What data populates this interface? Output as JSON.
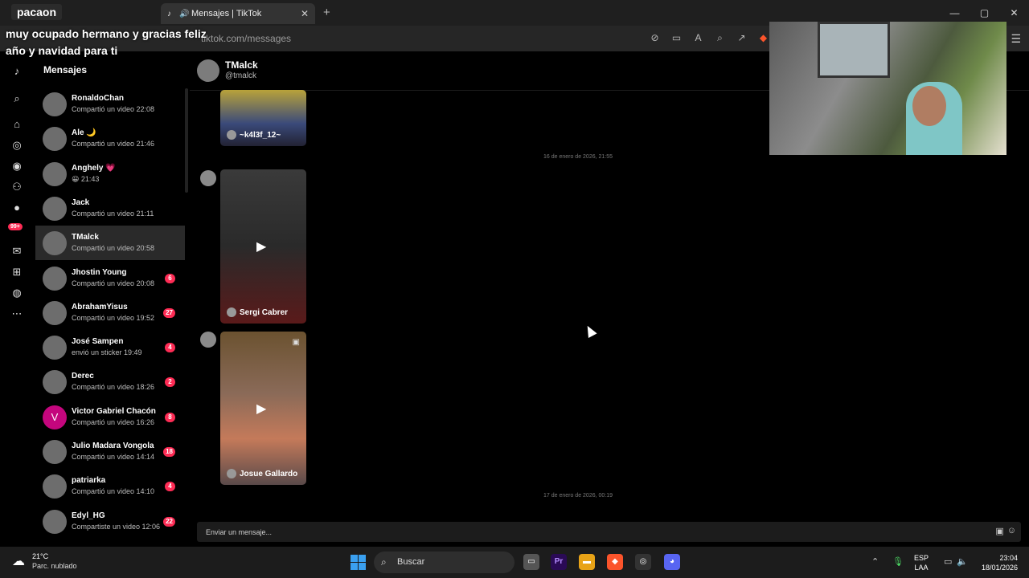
{
  "stream": {
    "user_tag": "pacaon",
    "message": "muy ocupado hermano y gracias feliz año y navidad para ti"
  },
  "browser": {
    "tab_title": "Mensajes | TikTok",
    "new_tab": "+",
    "url": "tiktok.com/messages",
    "win_min": "—",
    "win_max": "▢",
    "win_close": "✕"
  },
  "sidebar": {
    "title": "Mensajes",
    "rail_badge": "99+",
    "conversations": [
      {
        "name": "RonaldoChan",
        "preview": "Compartió un video 22:08",
        "count": ""
      },
      {
        "name": "Ale 🌙",
        "preview": "Compartió un video 21:46",
        "count": ""
      },
      {
        "name": "Anghely 💗",
        "preview": "😀 21:43",
        "count": ""
      },
      {
        "name": "Jack",
        "preview": "Compartió un video 21:11",
        "count": ""
      },
      {
        "name": "TMalck",
        "preview": "Compartió un video 20:58",
        "count": ""
      },
      {
        "name": "Jhostin Young",
        "preview": "Compartió un video 20:08",
        "count": "6"
      },
      {
        "name": "AbrahamYisus",
        "preview": "Compartió un video 19:52",
        "count": "27"
      },
      {
        "name": "José Sampen",
        "preview": "envió un sticker 19:49",
        "count": "4"
      },
      {
        "name": "Derec",
        "preview": "Compartió un video 18:26",
        "count": "2"
      },
      {
        "name": "Victor Gabriel Chacón",
        "preview": "Compartió un video 16:26",
        "count": "8",
        "initial": "V"
      },
      {
        "name": "Julio Madara Vongola",
        "preview": "Compartió un video 14:14",
        "count": "18"
      },
      {
        "name": "patriarka",
        "preview": "Compartió un video 14:10",
        "count": "4"
      },
      {
        "name": "Edyl_HG",
        "preview": "Compartiste un video 12:06",
        "count": "22"
      }
    ]
  },
  "chat": {
    "name": "TMalck",
    "handle": "@tmalck",
    "cards": [
      {
        "author": "~k4l3f_12~"
      },
      {
        "author": "Sergi Cabrer"
      },
      {
        "author": "Josue Gallardo"
      }
    ],
    "dates": [
      "16 de enero de 2026, 21:55",
      "17 de enero de 2026, 00:19"
    ],
    "composer_placeholder": "Enviar un mensaje..."
  },
  "taskbar": {
    "temperature": "21°C",
    "condition": "Parc. nublado",
    "search_label": "Buscar",
    "lang_line1": "ESP",
    "lang_line2": "LAA",
    "time": "23:04",
    "date": "18/01/2026"
  },
  "colors": {
    "accent": "#fe2c55",
    "background": "#000000"
  }
}
